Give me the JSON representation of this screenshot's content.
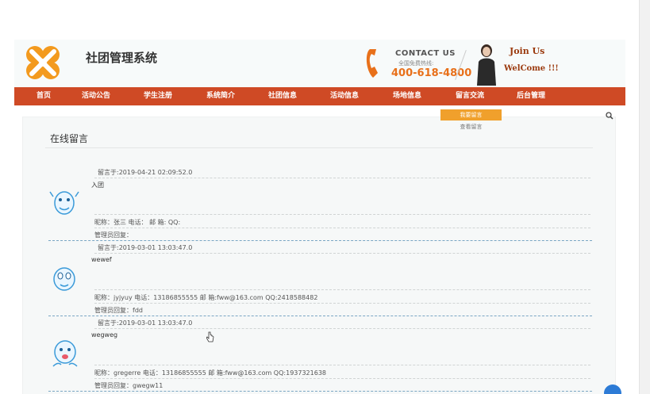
{
  "header": {
    "site_title": "社团管理系统",
    "contact_title": "CONTACT US",
    "contact_sub": "全国免费热线:",
    "contact_phone": "400-618-4800",
    "join": "Join Us",
    "welcome": "WelCome !!!"
  },
  "nav": {
    "items": [
      "首页",
      "活动公告",
      "学生注册",
      "系统简介",
      "社团信息",
      "活动信息",
      "场地信息",
      "留言交流",
      "后台管理"
    ]
  },
  "dropdown": {
    "active": "我要留言",
    "item": "查看留言"
  },
  "panel": {
    "title": "在线留言"
  },
  "messages": [
    {
      "date": "留言于:2019-04-21 02:09:52.0",
      "content": "入团",
      "info": "昵称：张三    电话：  邮 箱:   QQ:",
      "reply": "管理员回复："
    },
    {
      "date": "留言于:2019-03-01 13:03:47.0",
      "content": "wewef",
      "info": "昵称：jyjyuy    电话：13186855555 邮 箱:fww@163.com   QQ:2418588482",
      "reply": "管理员回复：fdd"
    },
    {
      "date": "留言于:2019-03-01 13:03:47.0",
      "content": "wegweg",
      "info": "昵称：gregerre    电话：13186855555  邮 箱:fww@163.com   QQ:1937321638",
      "reply": "管理员回复：gwegw11"
    }
  ],
  "colors": {
    "nav_bg": "#cf4a25",
    "accent_orange": "#f0a02c",
    "phone_orange": "#e8701a"
  }
}
